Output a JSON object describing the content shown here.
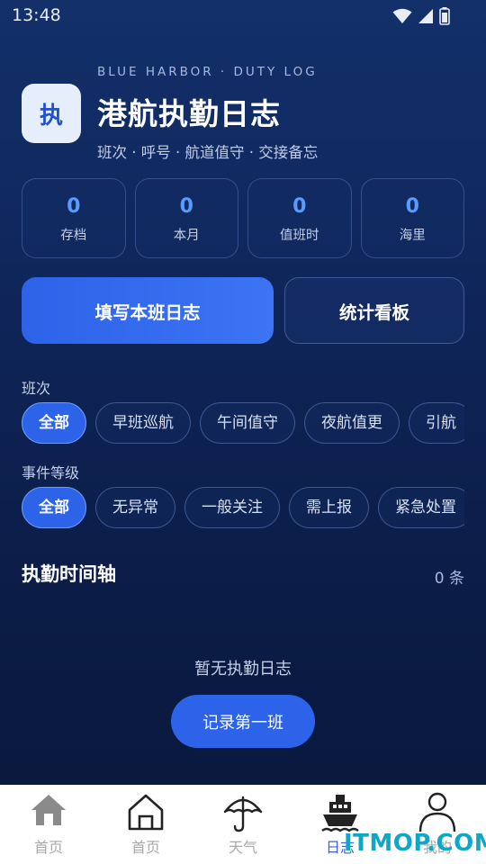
{
  "status_bar": {
    "time": "13:48"
  },
  "header": {
    "eyebrow": "BLUE HARBOR · DUTY LOG",
    "logo_char": "执",
    "title": "港航执勤日志",
    "subtitle": "班次 · 呼号 · 航道值守 · 交接备忘"
  },
  "stats": [
    {
      "value": "0",
      "label": "存档"
    },
    {
      "value": "0",
      "label": "本月"
    },
    {
      "value": "0",
      "label": "值班时"
    },
    {
      "value": "0",
      "label": "海里"
    }
  ],
  "actions": {
    "primary": "填写本班日志",
    "secondary": "统计看板"
  },
  "filters": {
    "shift_label": "班次",
    "shift_chips": [
      "全部",
      "早班巡航",
      "午间值守",
      "夜航值更",
      "引航"
    ],
    "level_label": "事件等级",
    "level_chips": [
      "全部",
      "无异常",
      "一般关注",
      "需上报",
      "紧急处置"
    ]
  },
  "timeline": {
    "title": "执勤时间轴",
    "count": "0 条",
    "empty_text": "暂无执勤日志",
    "first_button": "记录第一班"
  },
  "bottom_nav": [
    {
      "label": "首页",
      "icon": "house-filled-icon"
    },
    {
      "label": "首页",
      "icon": "house-outline-icon"
    },
    {
      "label": "天气",
      "icon": "umbrella-icon"
    },
    {
      "label": "日志",
      "icon": "ship-icon",
      "active": true
    },
    {
      "label": "我的",
      "icon": "person-icon"
    }
  ],
  "watermark": "ITMOP.COM",
  "colors": {
    "accent": "#2d63e8",
    "stat_value": "#5b9bff",
    "nav_active": "#3b63d8",
    "watermark": "#10a7c6"
  }
}
